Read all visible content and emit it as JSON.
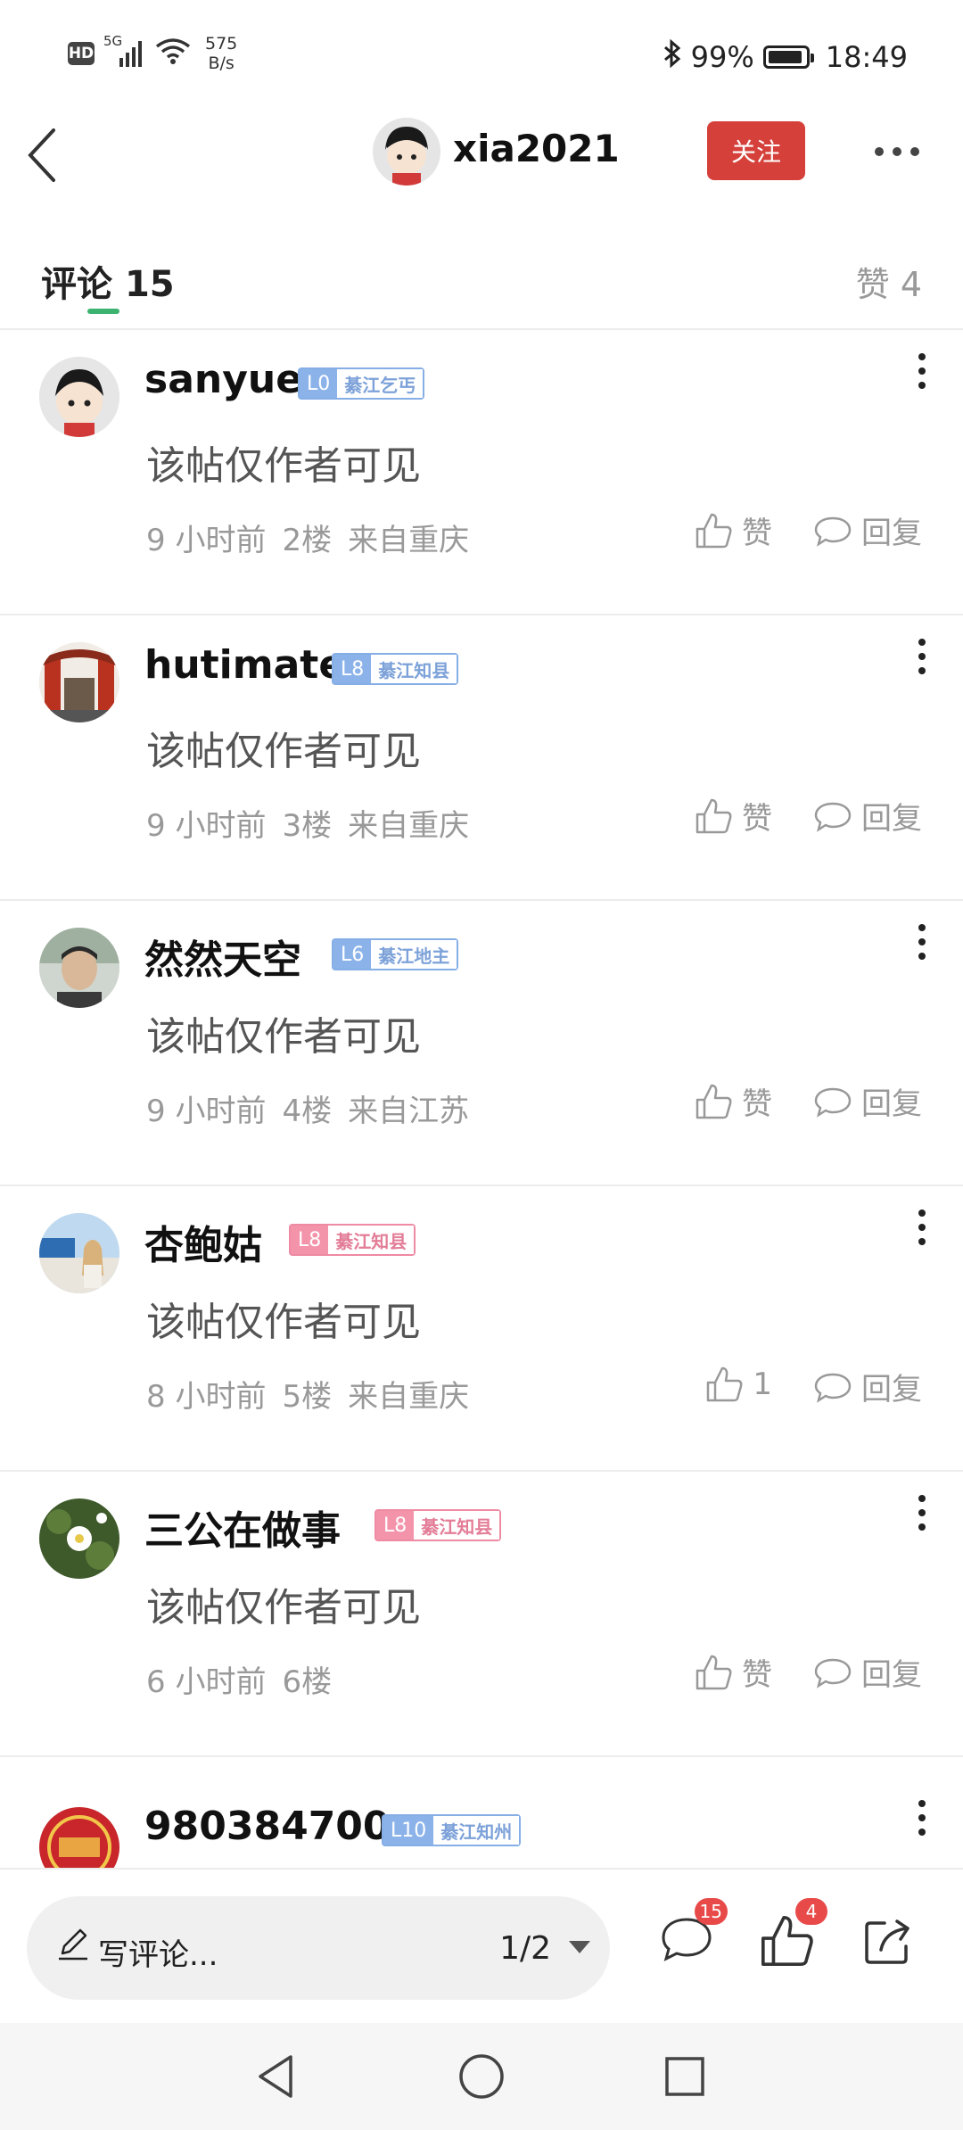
{
  "status_bar": {
    "hd": "HD",
    "signal": "5G",
    "net_speed_value": "575",
    "net_speed_unit": "B/s",
    "battery": "99%",
    "time": "18:49"
  },
  "header": {
    "username": "xia2021",
    "follow_label": "关注"
  },
  "tabs": {
    "comments_label": "评论",
    "comments_count": "15",
    "likes_label": "赞",
    "likes_count": "4"
  },
  "comments": [
    {
      "name": "sanyue",
      "level": "L0",
      "title": "綦江乞丐",
      "level_color": "blue",
      "text": "该帖仅作者可见",
      "time": "9 小时前",
      "floor": "2楼",
      "location": "来自重庆",
      "like_label": "赞",
      "reply_label": "回复",
      "avatar": "cartoon"
    },
    {
      "name": "hutimate",
      "level": "L8",
      "title": "綦江知县",
      "level_color": "blue",
      "text": "该帖仅作者可见",
      "time": "9 小时前",
      "floor": "3楼",
      "location": "来自重庆",
      "like_label": "赞",
      "reply_label": "回复",
      "avatar": "gate"
    },
    {
      "name": "然然天空",
      "level": "L6",
      "title": "綦江地主",
      "level_color": "blue",
      "text": "该帖仅作者可见",
      "time": "9 小时前",
      "floor": "4楼",
      "location": "来自江苏",
      "like_label": "赞",
      "reply_label": "回复",
      "avatar": "face"
    },
    {
      "name": "杏鲍姑",
      "level": "L8",
      "title": "綦江知县",
      "level_color": "pink",
      "text": "该帖仅作者可见",
      "time": "8 小时前",
      "floor": "5楼",
      "location": "来自重庆",
      "like_label": "1",
      "reply_label": "回复",
      "avatar": "girl"
    },
    {
      "name": "三公在做事",
      "level": "L8",
      "title": "綦江知县",
      "level_color": "pink",
      "text": "该帖仅作者可见",
      "time": "6 小时前",
      "floor": "6楼",
      "location": "",
      "like_label": "赞",
      "reply_label": "回复",
      "avatar": "flower"
    },
    {
      "name": "980384700",
      "level": "L10",
      "title": "綦江知州",
      "level_color": "blue",
      "text": "",
      "time": "",
      "floor": "",
      "location": "",
      "like_label": "",
      "reply_label": "",
      "avatar": "red"
    }
  ],
  "bottom_bar": {
    "write_placeholder": "写评论...",
    "page_indicator": "1/2",
    "comment_badge": "15",
    "like_badge": "4"
  },
  "colors": {
    "follow_red": "#d6403a",
    "tab_accent": "#3cb371",
    "level_blue": "#8bb3ea",
    "level_pink": "#f394ab",
    "badge_red": "#e84a4a"
  },
  "icons": [
    "back-icon",
    "more-icon",
    "thumb-up-icon",
    "chat-bubble-icon",
    "pencil-icon",
    "share-icon",
    "triangle-back-icon",
    "circle-home-icon",
    "square-recent-icon",
    "bluetooth-icon",
    "wifi-icon",
    "battery-icon",
    "signal-icon"
  ]
}
